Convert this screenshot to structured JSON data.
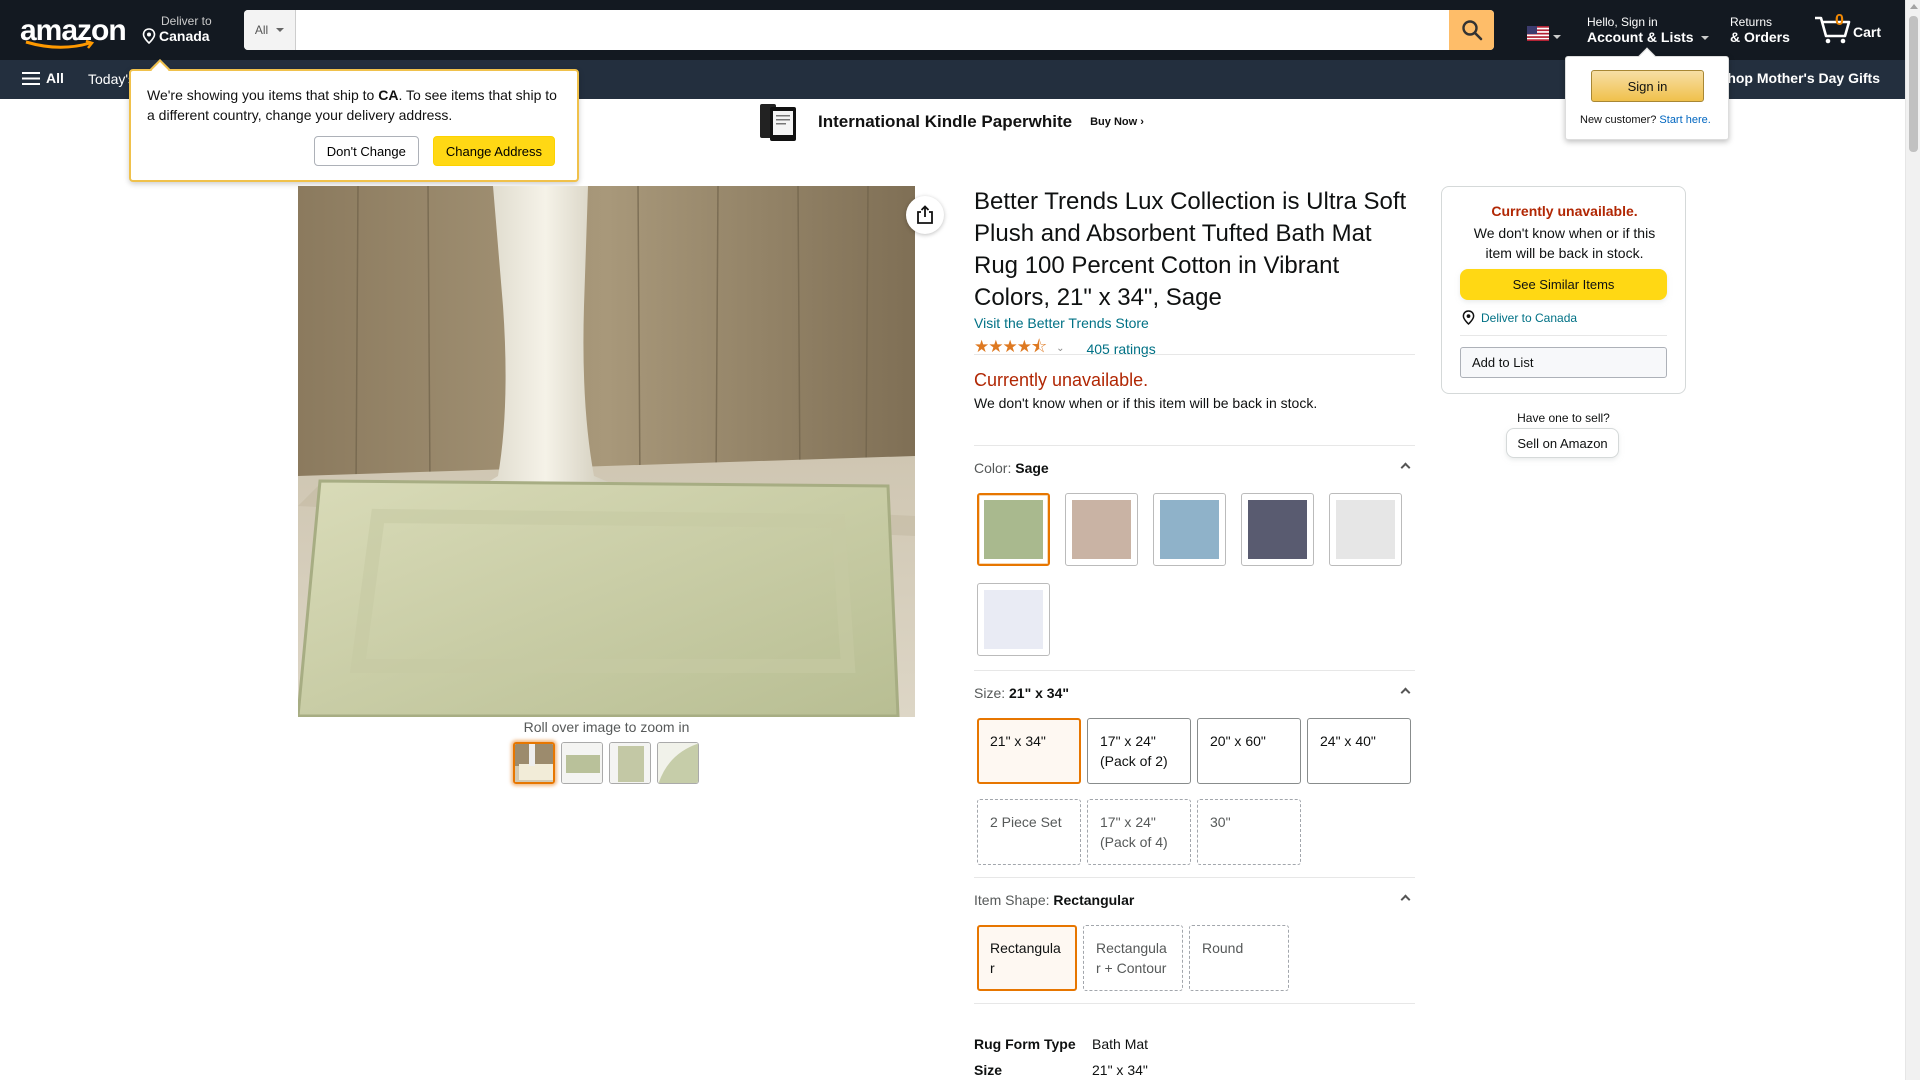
{
  "header": {
    "logo_text": "amazon",
    "deliver_label": "Deliver to",
    "deliver_location": "Canada",
    "search": {
      "category": "All",
      "placeholder": "",
      "value": ""
    },
    "account_greeting": "Hello, Sign in",
    "account_label": "Account & Lists",
    "returns_l1": "Returns",
    "returns_l2": "& Orders",
    "cart_count": "0",
    "cart_label": "Cart"
  },
  "subnav": {
    "all_label": "All",
    "today": "Today's",
    "promo": "Shop Mother's Day Gifts"
  },
  "banner": {
    "title": "International Kindle Paperwhite",
    "cta": "Buy Now ›"
  },
  "ship_popover": {
    "text_pre": "We're showing you items that ship to ",
    "country": "CA",
    "text_post": ". To see items that ship to a different country, change your delivery address.",
    "dont_change": "Don't Change",
    "change_address": "Change Address"
  },
  "signin_popover": {
    "button": "Sign in",
    "new_customer": "New customer?",
    "start_here": "Start here."
  },
  "gallery": {
    "zoom_hint": "Roll over image to zoom in",
    "thumbnails": [
      "thumb-1",
      "thumb-2",
      "thumb-3",
      "thumb-4"
    ]
  },
  "product": {
    "title": "Better Trends Lux Collection is Ultra Soft Plush and Absorbent Tufted Bath Mat Rug 100 Percent Cotton in Vibrant Colors, 21\" x 34\", Sage",
    "store_link": "Visit the Better Trends Store",
    "stars": "★★★★⯪",
    "rating_value": 4.5,
    "ratings_count": "405 ratings",
    "unavailable": "Currently unavailable.",
    "unavailable_sub": "We don't know when or if this item will be back in stock."
  },
  "options": {
    "color": {
      "label": "Color: ",
      "value": "Sage",
      "swatches": [
        {
          "name": "Sage",
          "color": "#a9b98e"
        },
        {
          "name": "Beige",
          "color": "#c9b3a4"
        },
        {
          "name": "Blue",
          "color": "#8fb2c9"
        },
        {
          "name": "Gray",
          "color": "#595b70"
        },
        {
          "name": "White",
          "color": "#e6e6e6"
        },
        {
          "name": "Light",
          "color": "#e9ebf4"
        }
      ]
    },
    "size": {
      "label": "Size: ",
      "value": "21\" x 34\"",
      "choices": [
        "21\" x 34\"",
        "17\" x 24\" (Pack of 2)",
        "20\" x 60\"",
        "24\" x 40\"",
        "2 Piece Set",
        "17\" x 24\" (Pack of 4)",
        "30\""
      ]
    },
    "shape": {
      "label": "Item Shape: ",
      "value": "Rectangular",
      "choices": [
        "Rectangula r",
        "Rectangula r + Contour",
        "Round"
      ]
    }
  },
  "specs": [
    {
      "key": "Rug Form Type",
      "value": "Bath Mat"
    },
    {
      "key": "Size",
      "value": "21\" x 34\""
    }
  ],
  "buybox": {
    "unavailable": "Currently unavailable.",
    "sub": "We don't know when or if this item will be back in stock.",
    "similar": "See Similar Items",
    "deliver": "Deliver to Canada",
    "add_to_list": "Add to List"
  },
  "sell": {
    "have_one": "Have one to sell?",
    "button": "Sell on Amazon"
  },
  "colors": {
    "nav_dark": "#131921",
    "nav_sub": "#232f3e",
    "accent": "#febd69",
    "link": "#007185",
    "price_red": "#b12704"
  }
}
